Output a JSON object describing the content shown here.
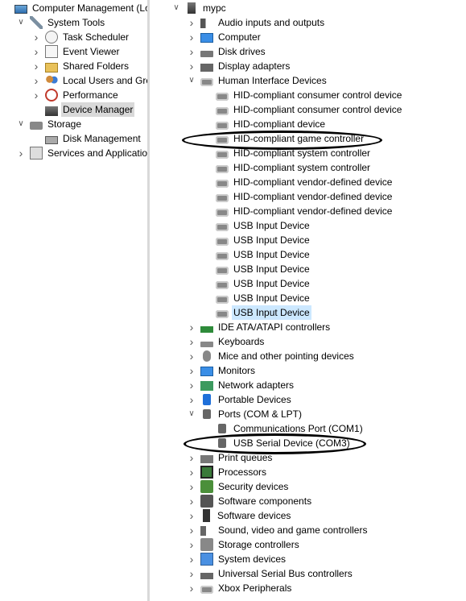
{
  "left_tree": [
    {
      "label": "Computer Management (Local",
      "indent": 0,
      "expander": "",
      "icon": "computer-management-icon",
      "cls": "i-comp"
    },
    {
      "label": "System Tools",
      "indent": 1,
      "expander": "open",
      "icon": "tools-icon",
      "cls": "i-tools"
    },
    {
      "label": "Task Scheduler",
      "indent": 2,
      "expander": "closed",
      "icon": "clock-icon",
      "cls": "i-clock"
    },
    {
      "label": "Event Viewer",
      "indent": 2,
      "expander": "closed",
      "icon": "event-viewer-icon",
      "cls": "i-event"
    },
    {
      "label": "Shared Folders",
      "indent": 2,
      "expander": "closed",
      "icon": "shared-folder-icon",
      "cls": "i-folder"
    },
    {
      "label": "Local Users and Groups",
      "indent": 2,
      "expander": "closed",
      "icon": "users-icon",
      "cls": "i-users"
    },
    {
      "label": "Performance",
      "indent": 2,
      "expander": "closed",
      "icon": "performance-icon",
      "cls": "i-perf"
    },
    {
      "label": "Device Manager",
      "indent": 2,
      "expander": "",
      "icon": "device-manager-icon",
      "cls": "i-devmgr",
      "selected": true
    },
    {
      "label": "Storage",
      "indent": 1,
      "expander": "open",
      "icon": "storage-icon",
      "cls": "i-storage"
    },
    {
      "label": "Disk Management",
      "indent": 2,
      "expander": "",
      "icon": "disk-icon",
      "cls": "i-disk"
    },
    {
      "label": "Services and Applications",
      "indent": 1,
      "expander": "closed",
      "icon": "services-icon",
      "cls": "i-svc"
    }
  ],
  "right_tree": [
    {
      "label": "mypc",
      "indent": 0,
      "expander": "open",
      "icon": "pc-icon",
      "cls": "i-pc"
    },
    {
      "label": "Audio inputs and outputs",
      "indent": 1,
      "expander": "closed",
      "icon": "audio-icon",
      "cls": "i-audio"
    },
    {
      "label": "Computer",
      "indent": 1,
      "expander": "closed",
      "icon": "monitor-icon",
      "cls": "i-monitor"
    },
    {
      "label": "Disk drives",
      "indent": 1,
      "expander": "closed",
      "icon": "disk-drive-icon",
      "cls": "i-drive"
    },
    {
      "label": "Display adapters",
      "indent": 1,
      "expander": "closed",
      "icon": "display-adapter-icon",
      "cls": "i-display"
    },
    {
      "label": "Human Interface Devices",
      "indent": 1,
      "expander": "open",
      "icon": "hid-icon",
      "cls": "i-hid"
    },
    {
      "label": "HID-compliant consumer control device",
      "indent": 2,
      "expander": "",
      "icon": "hid-icon",
      "cls": "i-hid"
    },
    {
      "label": "HID-compliant consumer control device",
      "indent": 2,
      "expander": "",
      "icon": "hid-icon",
      "cls": "i-hid"
    },
    {
      "label": "HID-compliant device",
      "indent": 2,
      "expander": "",
      "icon": "hid-icon",
      "cls": "i-hid"
    },
    {
      "label": "HID-compliant game controller",
      "indent": 2,
      "expander": "",
      "icon": "hid-icon",
      "cls": "i-hid"
    },
    {
      "label": "HID-compliant system controller",
      "indent": 2,
      "expander": "",
      "icon": "hid-icon",
      "cls": "i-hid"
    },
    {
      "label": "HID-compliant system controller",
      "indent": 2,
      "expander": "",
      "icon": "hid-icon",
      "cls": "i-hid"
    },
    {
      "label": "HID-compliant vendor-defined device",
      "indent": 2,
      "expander": "",
      "icon": "hid-icon",
      "cls": "i-hid"
    },
    {
      "label": "HID-compliant vendor-defined device",
      "indent": 2,
      "expander": "",
      "icon": "hid-icon",
      "cls": "i-hid"
    },
    {
      "label": "HID-compliant vendor-defined device",
      "indent": 2,
      "expander": "",
      "icon": "hid-icon",
      "cls": "i-hid"
    },
    {
      "label": "USB Input Device",
      "indent": 2,
      "expander": "",
      "icon": "hid-icon",
      "cls": "i-hid"
    },
    {
      "label": "USB Input Device",
      "indent": 2,
      "expander": "",
      "icon": "hid-icon",
      "cls": "i-hid"
    },
    {
      "label": "USB Input Device",
      "indent": 2,
      "expander": "",
      "icon": "hid-icon",
      "cls": "i-hid"
    },
    {
      "label": "USB Input Device",
      "indent": 2,
      "expander": "",
      "icon": "hid-icon",
      "cls": "i-hid"
    },
    {
      "label": "USB Input Device",
      "indent": 2,
      "expander": "",
      "icon": "hid-icon",
      "cls": "i-hid"
    },
    {
      "label": "USB Input Device",
      "indent": 2,
      "expander": "",
      "icon": "hid-icon",
      "cls": "i-hid"
    },
    {
      "label": "USB Input Device",
      "indent": 2,
      "expander": "",
      "icon": "hid-icon",
      "cls": "i-hid",
      "selected": true
    },
    {
      "label": "IDE ATA/ATAPI controllers",
      "indent": 1,
      "expander": "closed",
      "icon": "ide-controller-icon",
      "cls": "i-ide"
    },
    {
      "label": "Keyboards",
      "indent": 1,
      "expander": "closed",
      "icon": "keyboard-icon",
      "cls": "i-kbd"
    },
    {
      "label": "Mice and other pointing devices",
      "indent": 1,
      "expander": "closed",
      "icon": "mouse-icon",
      "cls": "i-mouse"
    },
    {
      "label": "Monitors",
      "indent": 1,
      "expander": "closed",
      "icon": "monitor-icon",
      "cls": "i-monitor"
    },
    {
      "label": "Network adapters",
      "indent": 1,
      "expander": "closed",
      "icon": "network-adapter-icon",
      "cls": "i-net"
    },
    {
      "label": "Portable Devices",
      "indent": 1,
      "expander": "closed",
      "icon": "portable-device-icon",
      "cls": "i-portable"
    },
    {
      "label": "Ports (COM & LPT)",
      "indent": 1,
      "expander": "open",
      "icon": "port-icon",
      "cls": "i-port"
    },
    {
      "label": "Communications Port (COM1)",
      "indent": 2,
      "expander": "",
      "icon": "port-icon",
      "cls": "i-port"
    },
    {
      "label": "USB Serial Device (COM3)",
      "indent": 2,
      "expander": "",
      "icon": "port-icon",
      "cls": "i-port"
    },
    {
      "label": "Print queues",
      "indent": 1,
      "expander": "closed",
      "icon": "printer-icon",
      "cls": "i-print"
    },
    {
      "label": "Processors",
      "indent": 1,
      "expander": "closed",
      "icon": "processor-icon",
      "cls": "i-cpu"
    },
    {
      "label": "Security devices",
      "indent": 1,
      "expander": "closed",
      "icon": "security-device-icon",
      "cls": "i-sec"
    },
    {
      "label": "Software components",
      "indent": 1,
      "expander": "closed",
      "icon": "software-component-icon",
      "cls": "i-swcomp"
    },
    {
      "label": "Software devices",
      "indent": 1,
      "expander": "closed",
      "icon": "software-device-icon",
      "cls": "i-swdev"
    },
    {
      "label": "Sound, video and game controllers",
      "indent": 1,
      "expander": "closed",
      "icon": "sound-icon",
      "cls": "i-sound"
    },
    {
      "label": "Storage controllers",
      "indent": 1,
      "expander": "closed",
      "icon": "storage-controller-icon",
      "cls": "i-storctl"
    },
    {
      "label": "System devices",
      "indent": 1,
      "expander": "closed",
      "icon": "system-device-icon",
      "cls": "i-sysdev"
    },
    {
      "label": "Universal Serial Bus controllers",
      "indent": 1,
      "expander": "closed",
      "icon": "usb-icon",
      "cls": "i-usb"
    },
    {
      "label": "Xbox Peripherals",
      "indent": 1,
      "expander": "closed",
      "icon": "xbox-peripheral-icon",
      "cls": "i-hid"
    }
  ],
  "annotations": [
    {
      "name": "circle-annotation-game-controller",
      "target_index": 9
    },
    {
      "name": "circle-annotation-usb-serial",
      "target_index": 30
    }
  ],
  "colors": {
    "selection": "#cce8ff",
    "selection_inactive": "#d9d9d9"
  }
}
